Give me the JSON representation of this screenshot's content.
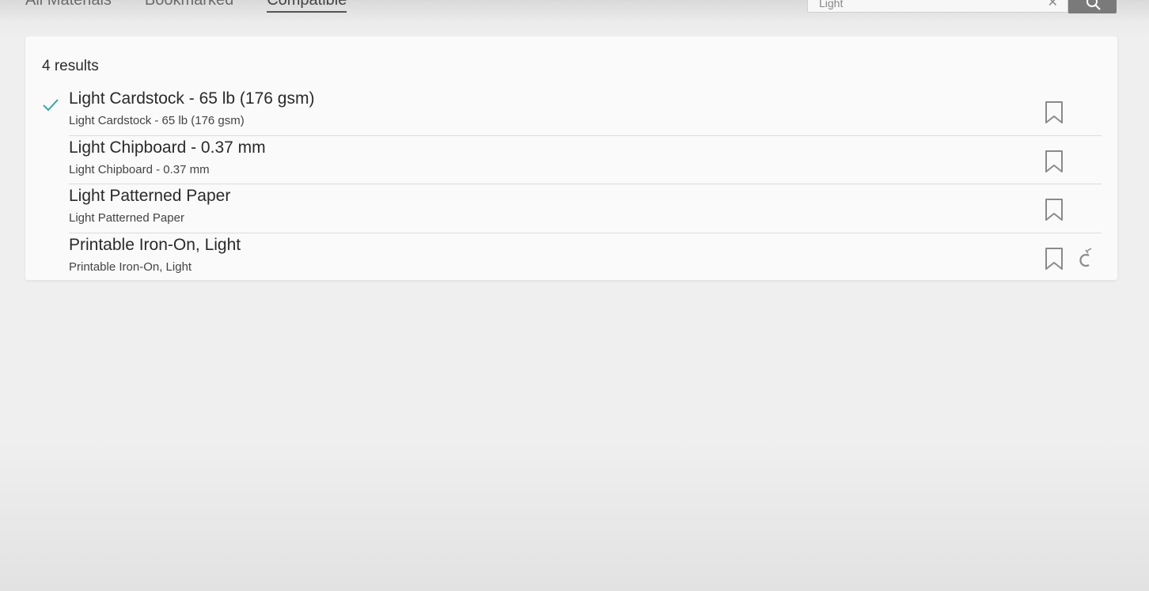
{
  "tabs": [
    {
      "label": "All Materials"
    },
    {
      "label": "Bookmarked"
    },
    {
      "label": "Compatible"
    }
  ],
  "search": {
    "value": "Light"
  },
  "results": {
    "count_label": "4 results",
    "items": [
      {
        "name": "Light Cardstock - 65 lb (176 gsm)",
        "subtitle": "Light Cardstock - 65 lb (176 gsm)",
        "selected": true
      },
      {
        "name": "Light Chipboard - 0.37 mm",
        "subtitle": "Light Chipboard - 0.37 mm",
        "selected": false
      },
      {
        "name": "Light Patterned Paper",
        "subtitle": "Light Patterned Paper",
        "selected": false
      },
      {
        "name": "Printable Iron-On, Light",
        "subtitle": "Printable Iron-On, Light",
        "selected": false
      }
    ]
  },
  "colors": {
    "check": "#3aa8a0",
    "icon": "#8a8a8a"
  }
}
